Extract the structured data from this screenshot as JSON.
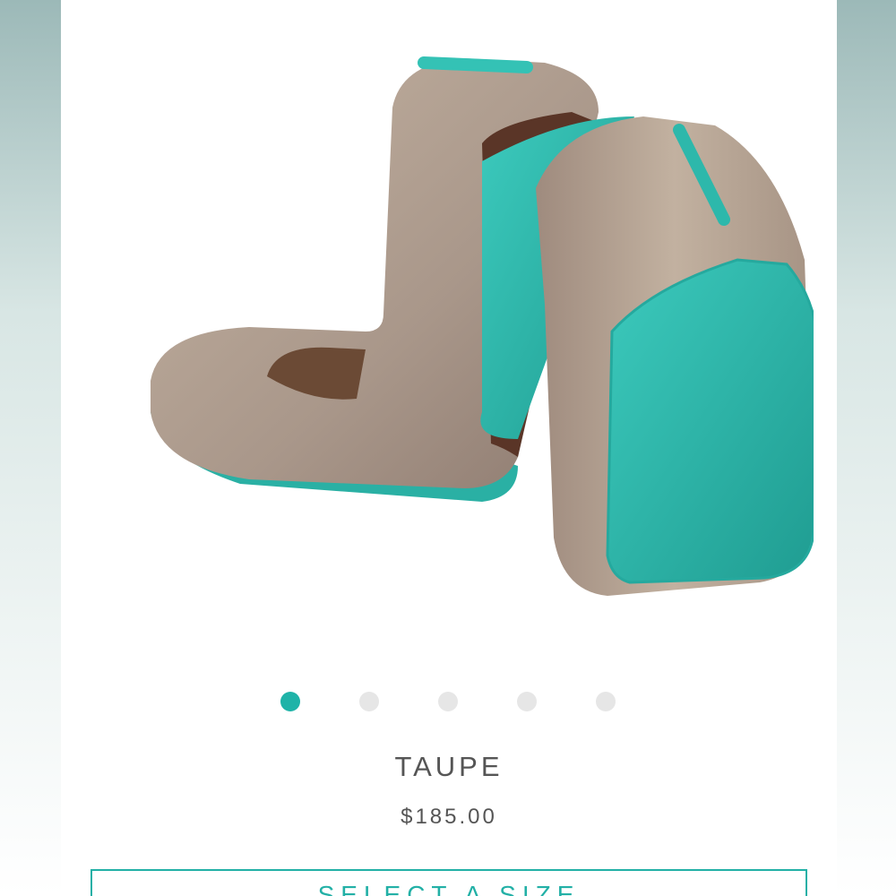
{
  "product": {
    "name": "TAUPE",
    "price": "$185.00",
    "image_alt": "Taupe ballet flats with turquoise soles",
    "colors": {
      "leather": "#b29f8e",
      "sole": "#2fb5a8",
      "accent": "#22b0a6"
    }
  },
  "carousel": {
    "total": 5,
    "active_index": 0,
    "active_color": "#1fb3a8",
    "inactive_color": "#e6e6e6"
  },
  "actions": {
    "select_size_label": "SELECT A SIZE"
  }
}
